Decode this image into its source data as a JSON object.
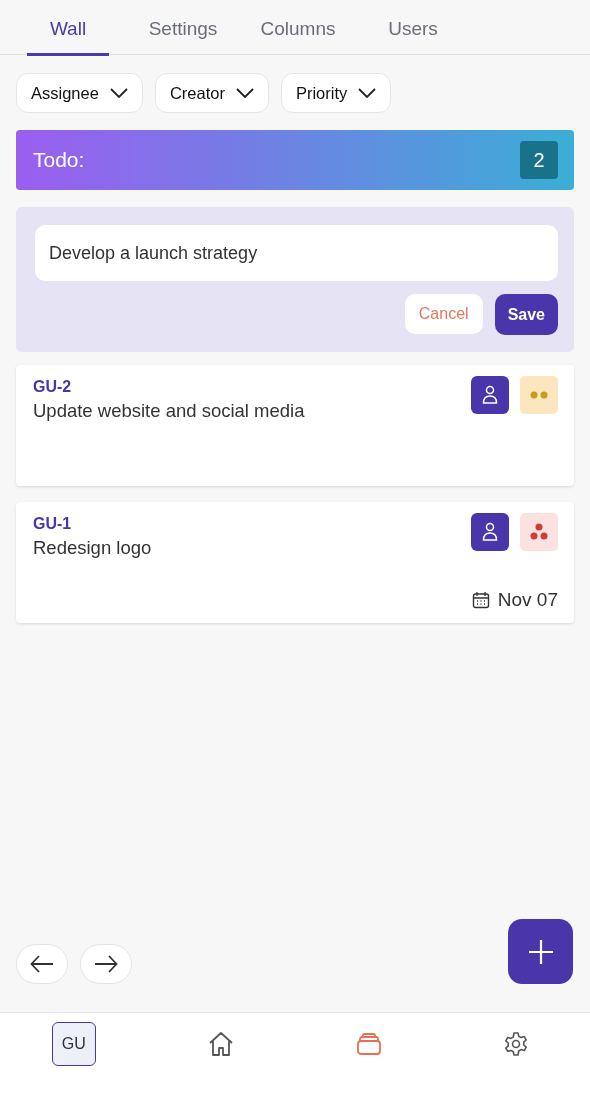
{
  "tabs": [
    {
      "label": "Wall",
      "selected": true
    },
    {
      "label": "Settings",
      "selected": false
    },
    {
      "label": "Columns",
      "selected": false
    },
    {
      "label": "Users",
      "selected": false
    }
  ],
  "filters": [
    "Assignee",
    "Creator",
    "Priority"
  ],
  "column": {
    "title": "Todo:",
    "count": "2"
  },
  "new_card": {
    "value": "Develop a launch strategy",
    "cancel": "Cancel",
    "save": "Save"
  },
  "cards": [
    {
      "key": "GU-2",
      "title": "Update website and social media",
      "priority_badge": {
        "kind": "medium"
      }
    },
    {
      "key": "GU-1",
      "title": "Redesign logo",
      "priority_badge": {
        "kind": "high"
      },
      "due": "Nov 07"
    }
  ],
  "bottom_nav": [
    {
      "kind": "avatar",
      "label": "GU",
      "selected": false
    },
    {
      "kind": "home",
      "selected": false
    },
    {
      "kind": "boards",
      "selected": true
    },
    {
      "kind": "settings",
      "selected": false
    }
  ]
}
